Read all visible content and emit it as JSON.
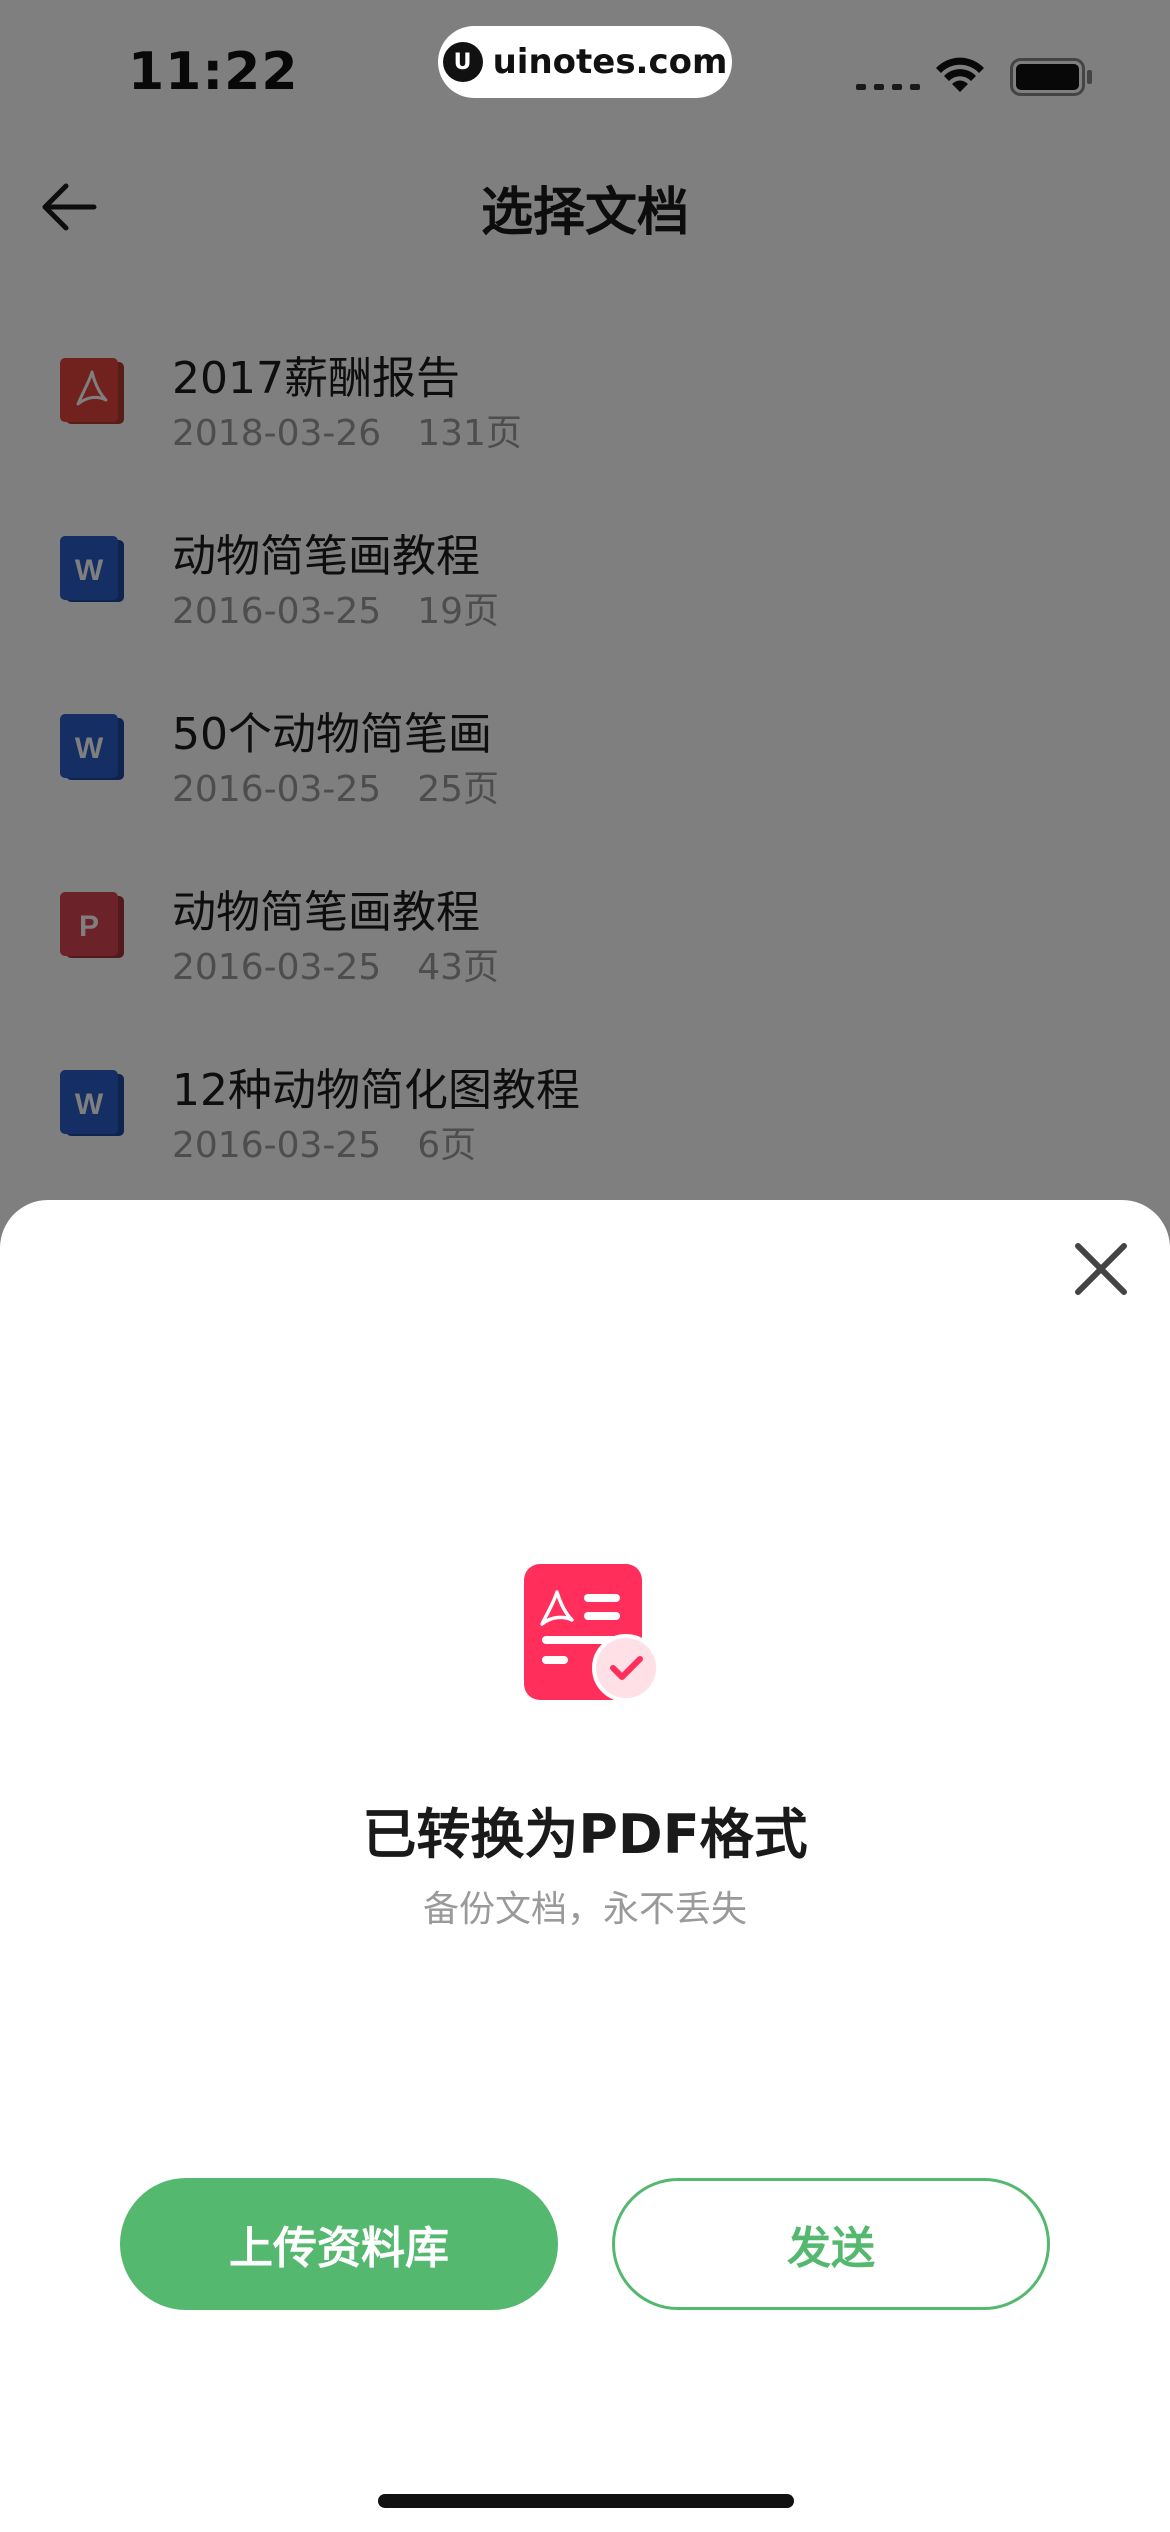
{
  "status_bar": {
    "time": "11:22",
    "watermark_text": "uinotes.com",
    "icons": [
      "signal-icon",
      "wifi-icon",
      "battery-icon"
    ]
  },
  "nav": {
    "back_icon": "back-arrow-icon",
    "title": "选择文档"
  },
  "documents": [
    {
      "type": "pdf",
      "icon_letter": "",
      "name": "2017薪酬报告",
      "date": "2018-03-26",
      "pages": "131页"
    },
    {
      "type": "word",
      "icon_letter": "W",
      "name": "动物简笔画教程",
      "date": "2016-03-25",
      "pages": "19页"
    },
    {
      "type": "word",
      "icon_letter": "W",
      "name": "50个动物简笔画",
      "date": "2016-03-25",
      "pages": "25页"
    },
    {
      "type": "ppt",
      "icon_letter": "P",
      "name": "动物简笔画教程",
      "date": "2016-03-25",
      "pages": "43页"
    },
    {
      "type": "word",
      "icon_letter": "W",
      "name": "12种动物简化图教程",
      "date": "2016-03-25",
      "pages": "6页"
    }
  ],
  "sheet": {
    "close_icon": "close-icon",
    "illustration_icon": "pdf-converted-icon",
    "title": "已转换为PDF格式",
    "subtitle": "备份文档，永不丢失",
    "upload_button": "上传资料库",
    "send_button": "发送"
  },
  "colors": {
    "accent_green": "#55b86f",
    "pdf_red": "#e2453c",
    "word_blue": "#2b5cc8",
    "ppt_red": "#d94452",
    "illustration_pink": "#ff2e5b",
    "overlay": "rgba(0,0,0,0.5)"
  }
}
